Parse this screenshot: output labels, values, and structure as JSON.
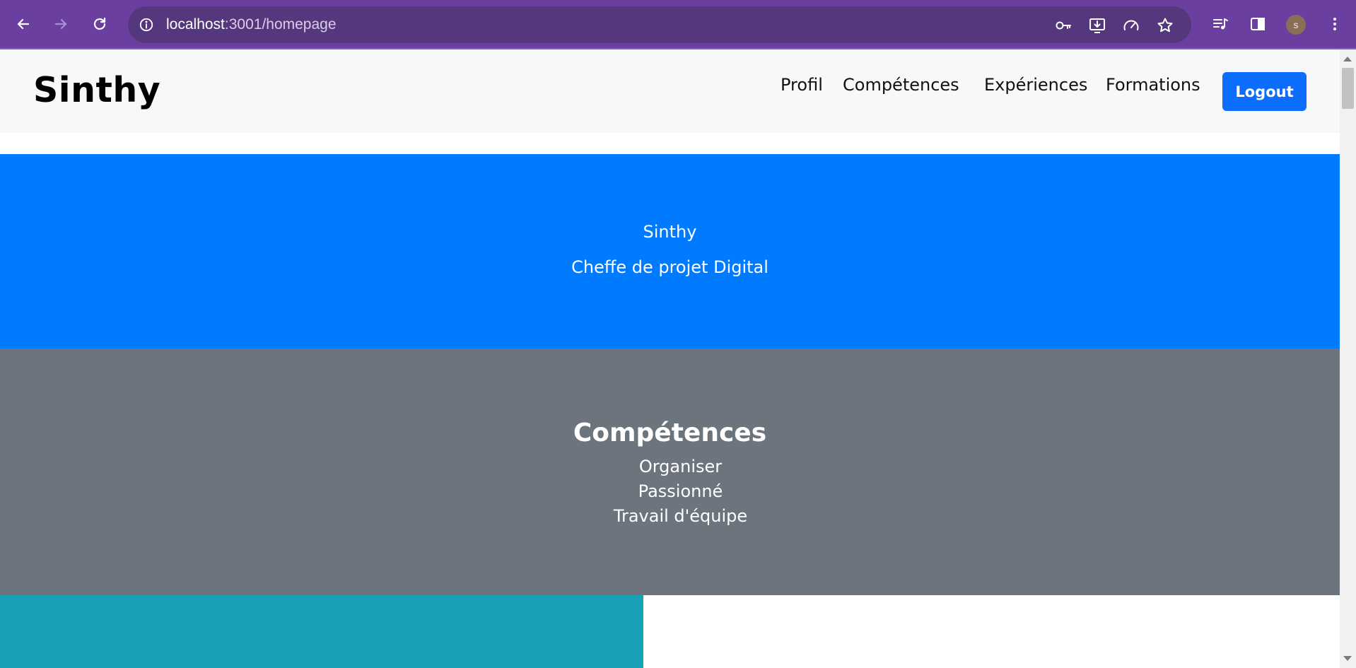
{
  "browser": {
    "url_host": "localhost",
    "url_path": ":3001/homepage",
    "profile_initial": "s",
    "icons": [
      "back-icon",
      "forward-icon",
      "reload-icon",
      "site-info-icon",
      "key-icon",
      "install-app-icon",
      "performance-icon",
      "star-icon",
      "media-icon",
      "side-panel-icon",
      "menu-icon"
    ]
  },
  "navbar": {
    "brand": "Sinthy",
    "links": [
      "Profil",
      "Compétences",
      "Expériences",
      "Formations"
    ],
    "logout_label": "Logout"
  },
  "hero": {
    "name": "Sinthy",
    "title": "Cheffe de projet Digital"
  },
  "skills": {
    "heading": "Compétences",
    "items": [
      "Organiser",
      "Passionné",
      "Travail d'équipe"
    ]
  },
  "colors": {
    "browser_frame": "#6b3fa0",
    "omnibox": "#54377d",
    "navbar_bg": "#f7f8fa",
    "logout_bg": "#0d6efd",
    "hero_bg": "#007bff",
    "skills_bg": "#6c757d",
    "teal_block": "#17a2b8"
  }
}
